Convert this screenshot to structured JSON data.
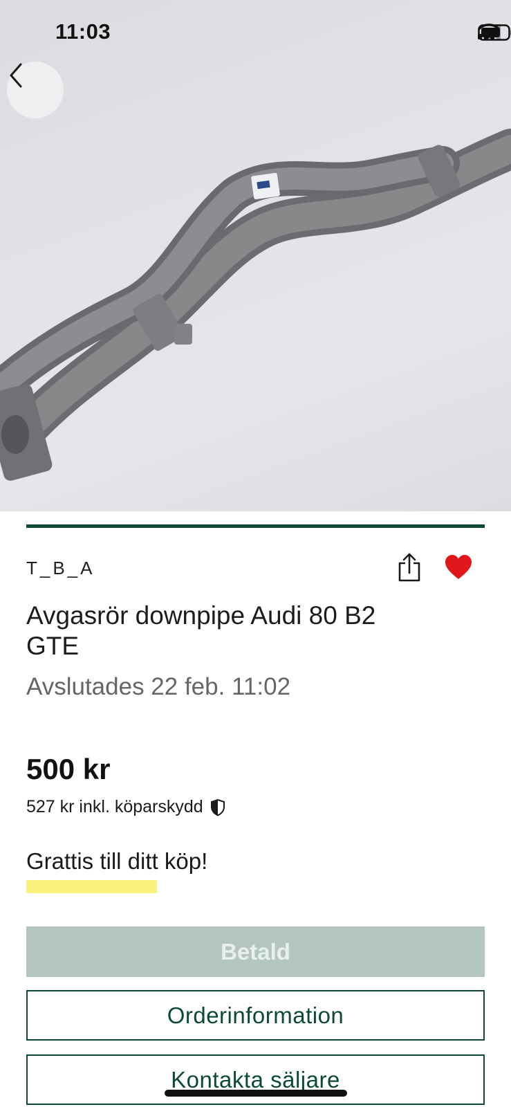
{
  "status_bar": {
    "time": "11:03"
  },
  "listing": {
    "seller": "T_B_A",
    "title": "Avgasrör downpipe Audi 80 B2 GTE",
    "ended": "Avslutades 22 feb. 11:02",
    "price": "500 kr",
    "price_incl": "527 kr inkl. köparskydd",
    "congrats": "Grattis till ditt köp!"
  },
  "buttons": {
    "paid": "Betald",
    "order_info": "Orderinformation",
    "contact_seller": "Kontakta säljare"
  },
  "colors": {
    "brand_green": "#0d4a34",
    "disabled_green": "#b2c6bf",
    "favorite_red": "#e0161b",
    "highlight_yellow": "#f8f37c"
  },
  "icons": {
    "back": "chevron-left-icon",
    "share": "share-icon",
    "favorite": "heart-icon",
    "buyer_protection": "shield-icon"
  }
}
